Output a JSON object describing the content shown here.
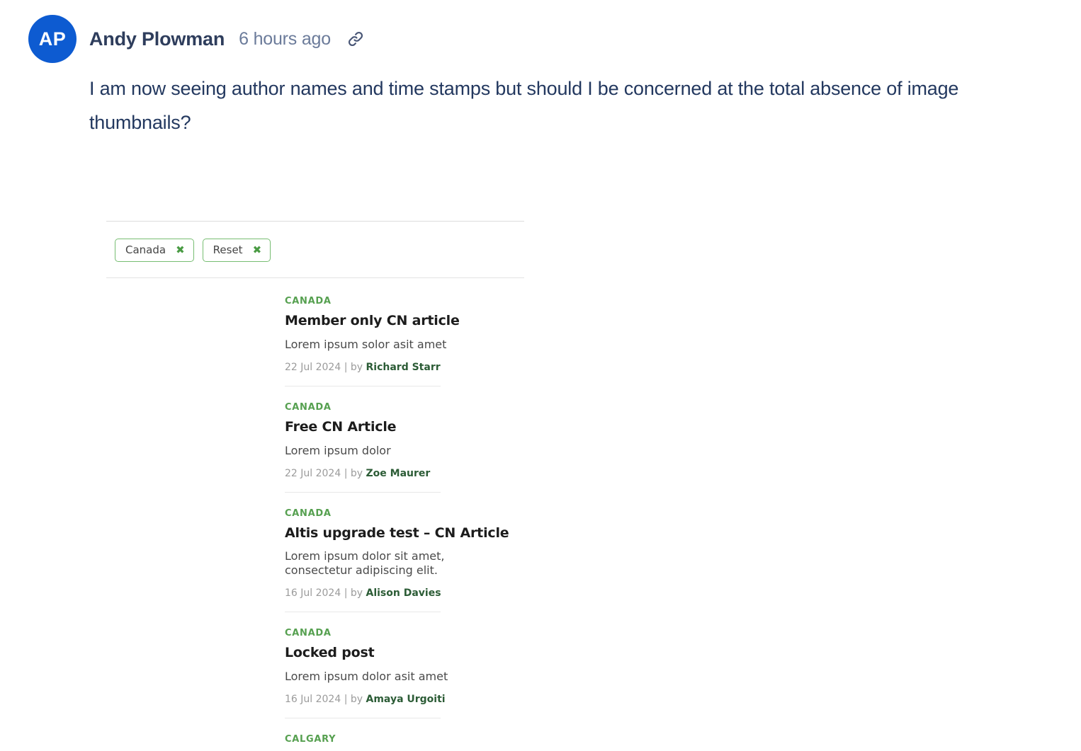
{
  "comment": {
    "avatar_initials": "AP",
    "avatar_color": "#0d5bd1",
    "author": "Andy Plowman",
    "timestamp": "6 hours ago",
    "permalink_icon": "link-icon",
    "body": "I am now seeing author names and time stamps but should I be concerned at the total absence of image thumbnails?"
  },
  "embed": {
    "filters": {
      "chips": [
        {
          "label": "Canada",
          "remove_icon": "✖"
        },
        {
          "label": "Reset",
          "remove_icon": "✖"
        }
      ]
    },
    "accent_green": "#56a050",
    "chip_border": "#77bd72",
    "articles": [
      {
        "category": "CANADA",
        "title": "Member only CN article",
        "excerpt": "Lorem ipsum solor asit amet",
        "date": "22 Jul 2024",
        "by_label": "| by",
        "author": "Richard Starr"
      },
      {
        "category": "CANADA",
        "title": "Free CN Article",
        "excerpt": "Lorem ipsum dolor",
        "date": "22 Jul 2024",
        "by_label": "| by",
        "author": "Zoe Maurer"
      },
      {
        "category": "CANADA",
        "title": "Altis upgrade test – CN Article",
        "excerpt": "Lorem ipsum dolor sit amet, consectetur adipiscing elit.",
        "date": "16 Jul 2024",
        "by_label": "| by",
        "author": "Alison Davies"
      },
      {
        "category": "CANADA",
        "title": "Locked post",
        "excerpt": "Lorem ipsum dolor asit amet",
        "date": "16 Jul 2024",
        "by_label": "| by",
        "author": "Amaya Urgoiti"
      },
      {
        "category": "CALGARY",
        "title": "",
        "excerpt": "",
        "date": "",
        "by_label": "",
        "author": ""
      }
    ]
  }
}
